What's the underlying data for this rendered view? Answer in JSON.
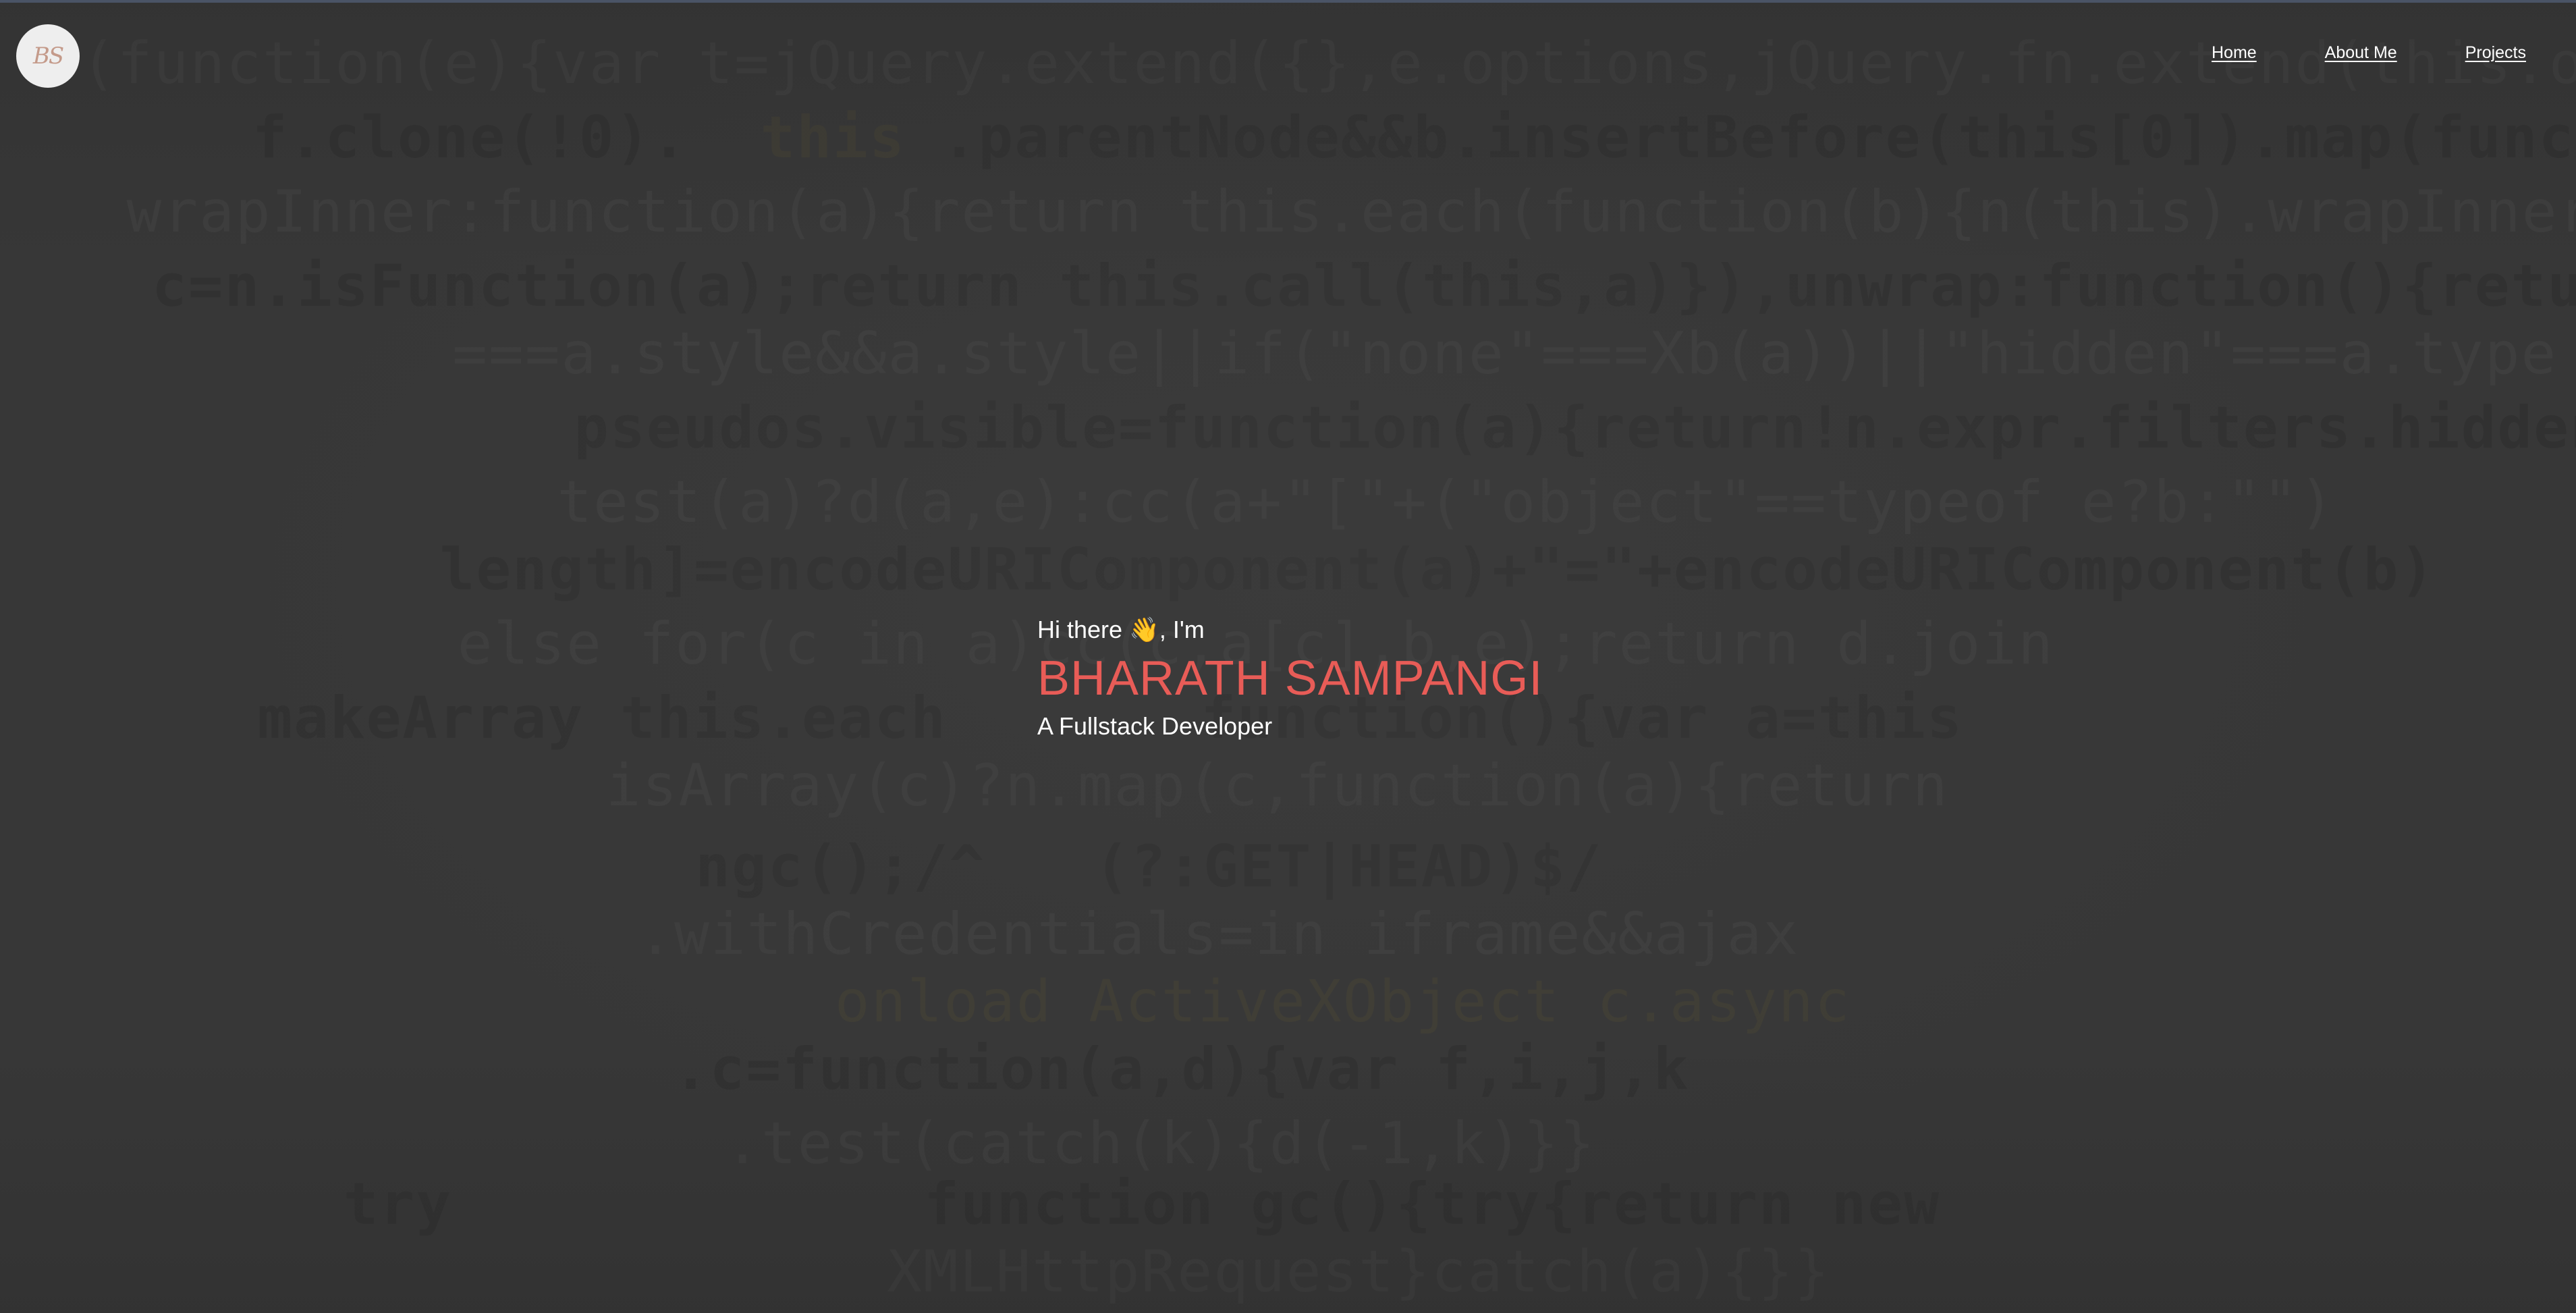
{
  "header": {
    "logo_text": "BS",
    "nav": [
      {
        "label": "Home"
      },
      {
        "label": "About Me"
      },
      {
        "label": "Projects"
      }
    ]
  },
  "hero": {
    "greeting": "Hi there 👋, I'm",
    "name": "BHARATH SAMPANGI",
    "role": "A Fullstack Developer"
  },
  "colors": {
    "background": "#373737",
    "accent": "#e85c57",
    "text": "#ffffff",
    "logo_bg": "#eeeeee"
  }
}
